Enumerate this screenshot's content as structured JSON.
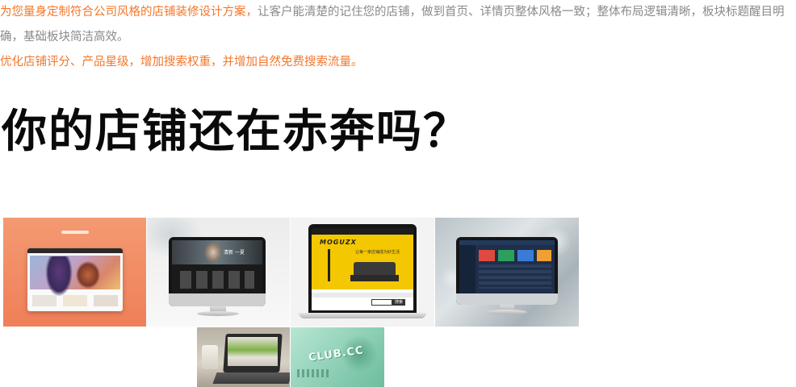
{
  "intro": {
    "highlight": "为您量身定制符合公司风格的店铺装修设计方案，",
    "rest": "让客户能清楚的记住您的店铺，做到首页、详情页整体风格一致；整体布局逻辑清晰，板块标题醒目明确，基础板块简洁高效。",
    "line3": "优化店铺评分、产品星级，增加搜索权重，并增加自然免费搜索流量。"
  },
  "headline": "你的店铺还在赤奔吗？",
  "showcase": {
    "tile2_banner_text": "清新 一夏",
    "tile3_logo": "MOGUZX",
    "tile3_tagline": "让每一家店铺成为好生活",
    "tile3_search": "搜索",
    "tile5_logo": "CLUB.CC"
  },
  "colors": {
    "orange": "#f4762a",
    "gray_text": "#8a8a8a",
    "headline": "#0a0a0a",
    "tile1_bg": "#f08a63",
    "tile3_yellow": "#f4c800",
    "tile4_header": "#243a5c",
    "tile5_bg": "#9bd8c1"
  }
}
